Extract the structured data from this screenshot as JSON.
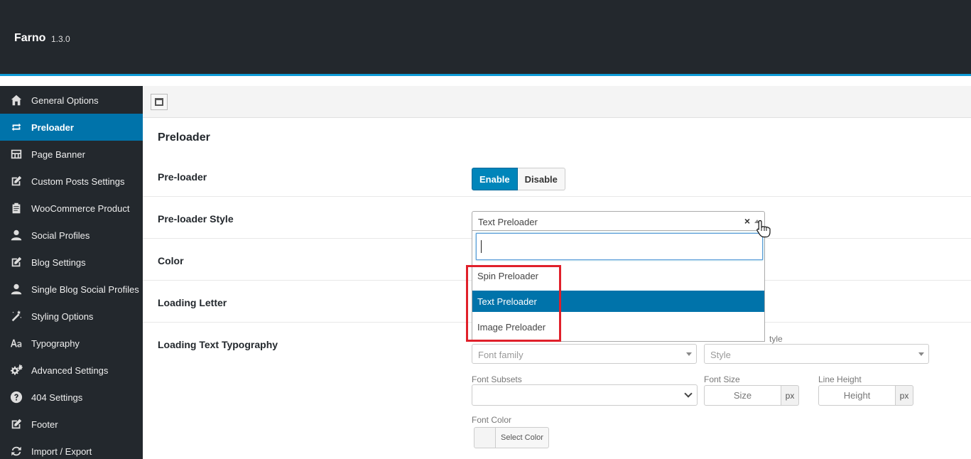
{
  "header": {
    "brand": "Farno",
    "version": "1.3.0"
  },
  "sidebar": {
    "items": [
      {
        "label": "General Options",
        "icon": "home-icon",
        "active": false
      },
      {
        "label": "Preloader",
        "icon": "loop-icon",
        "active": true
      },
      {
        "label": "Page Banner",
        "icon": "banner-icon",
        "active": false
      },
      {
        "label": "Custom Posts Settings",
        "icon": "edit-icon",
        "active": false
      },
      {
        "label": "WooCommerce Product",
        "icon": "clipboard-icon",
        "active": false
      },
      {
        "label": "Social Profiles",
        "icon": "user-icon",
        "active": false
      },
      {
        "label": "Blog Settings",
        "icon": "edit-icon",
        "active": false
      },
      {
        "label": "Single Blog Social Profiles",
        "icon": "user-icon",
        "active": false
      },
      {
        "label": "Styling Options",
        "icon": "magic-wand-icon",
        "active": false
      },
      {
        "label": "Typography",
        "icon": "typography-icon",
        "active": false
      },
      {
        "label": "Advanced Settings",
        "icon": "gears-icon",
        "active": false
      },
      {
        "label": "404 Settings",
        "icon": "help-icon",
        "active": false
      },
      {
        "label": "Footer",
        "icon": "edit-icon",
        "active": false
      },
      {
        "label": "Import / Export",
        "icon": "refresh-icon",
        "active": false
      }
    ]
  },
  "main": {
    "section_title": "Preloader",
    "preloader": {
      "label": "Pre-loader",
      "enable": "Enable",
      "disable": "Disable",
      "value": "Enable"
    },
    "style": {
      "label": "Pre-loader Style",
      "selected": "Text Preloader",
      "clear": "×",
      "search_value": "",
      "options": [
        "Spin Preloader",
        "Text Preloader",
        "Image Preloader"
      ]
    },
    "color": {
      "label": "Color"
    },
    "loading_letter": {
      "label": "Loading Letter"
    },
    "typography": {
      "label": "Loading Text Typography",
      "font_family_placeholder": "Font family",
      "style_label_visible": "tyle",
      "style_placeholder": "Style",
      "font_subsets_label": "Font Subsets",
      "font_size_label": "Font Size",
      "font_size_placeholder": "Size",
      "line_height_label": "Line Height",
      "line_height_placeholder": "Height",
      "unit": "px",
      "font_color_label": "Font Color",
      "select_color": "Select Color"
    }
  },
  "colors": {
    "header_bg": "#23282d",
    "accent": "#0073aa",
    "header_stripe": "#0f9bd7",
    "highlight": "#e0202a"
  }
}
